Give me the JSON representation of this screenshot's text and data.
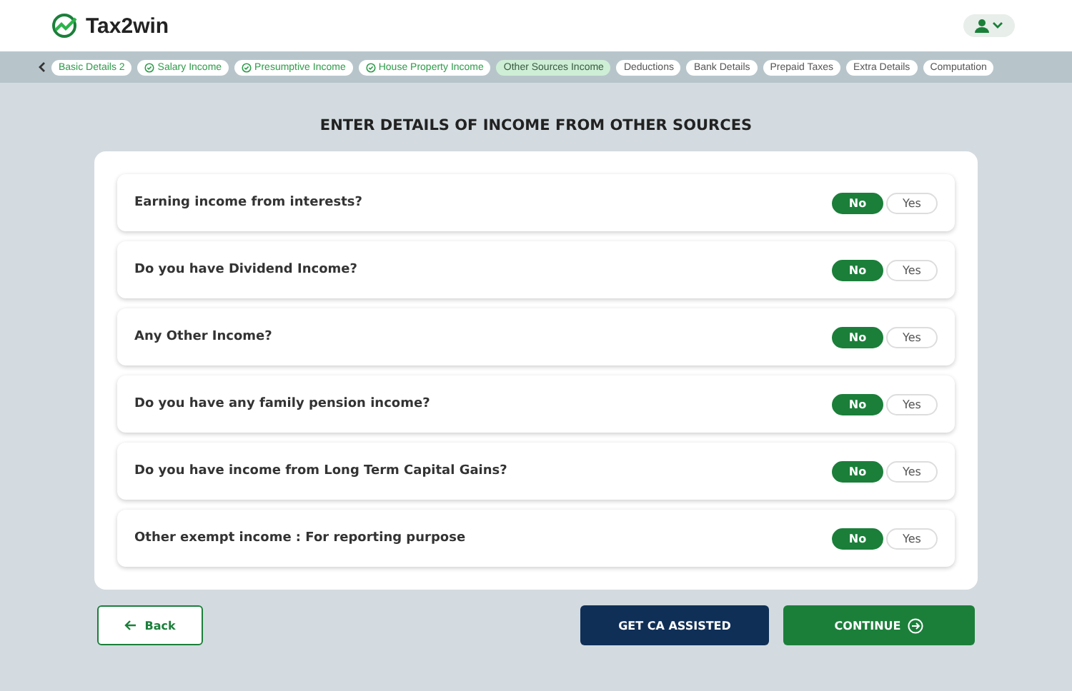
{
  "header": {
    "logo": "Tax2win"
  },
  "steps": [
    {
      "label": "Basic Details 2",
      "completed": true,
      "check": false,
      "selected": false
    },
    {
      "label": "Salary Income",
      "completed": true,
      "check": true,
      "selected": false
    },
    {
      "label": "Presumptive Income",
      "completed": true,
      "check": true,
      "selected": false
    },
    {
      "label": "House Property Income",
      "completed": true,
      "check": true,
      "selected": false
    },
    {
      "label": "Other Sources Income",
      "completed": false,
      "check": false,
      "selected": true
    },
    {
      "label": "Deductions",
      "completed": false,
      "check": false,
      "selected": false
    },
    {
      "label": "Bank Details",
      "completed": false,
      "check": false,
      "selected": false
    },
    {
      "label": "Prepaid Taxes",
      "completed": false,
      "check": false,
      "selected": false
    },
    {
      "label": "Extra Details",
      "completed": false,
      "check": false,
      "selected": false
    },
    {
      "label": "Computation",
      "completed": false,
      "check": false,
      "selected": false
    }
  ],
  "title": "ENTER DETAILS OF INCOME FROM OTHER SOURCES",
  "questions": [
    {
      "text": "Earning income from interests?",
      "options": [
        {
          "label": "No",
          "selected": true
        },
        {
          "label": "Yes",
          "selected": false
        }
      ]
    },
    {
      "text": "Do you have Dividend Income?",
      "options": [
        {
          "label": "No",
          "selected": true
        },
        {
          "label": "Yes",
          "selected": false
        }
      ]
    },
    {
      "text": "Any Other Income?",
      "options": [
        {
          "label": "No",
          "selected": true
        },
        {
          "label": "Yes",
          "selected": false
        }
      ]
    },
    {
      "text": "Do you have any family pension income?",
      "options": [
        {
          "label": "No",
          "selected": true
        },
        {
          "label": "Yes",
          "selected": false
        }
      ]
    },
    {
      "text": "Do you have income from Long Term Capital Gains?",
      "options": [
        {
          "label": "No",
          "selected": true
        },
        {
          "label": "Yes",
          "selected": false
        }
      ]
    },
    {
      "text": "Other exempt income : For reporting purpose",
      "options": [
        {
          "label": "No",
          "selected": true
        },
        {
          "label": "Yes",
          "selected": false
        }
      ]
    }
  ],
  "buttons": [
    {
      "kind": "back",
      "label": "Back"
    },
    {
      "kind": "assist",
      "label": "GET CA ASSISTED"
    },
    {
      "kind": "continue",
      "label": "CONTINUE"
    }
  ]
}
